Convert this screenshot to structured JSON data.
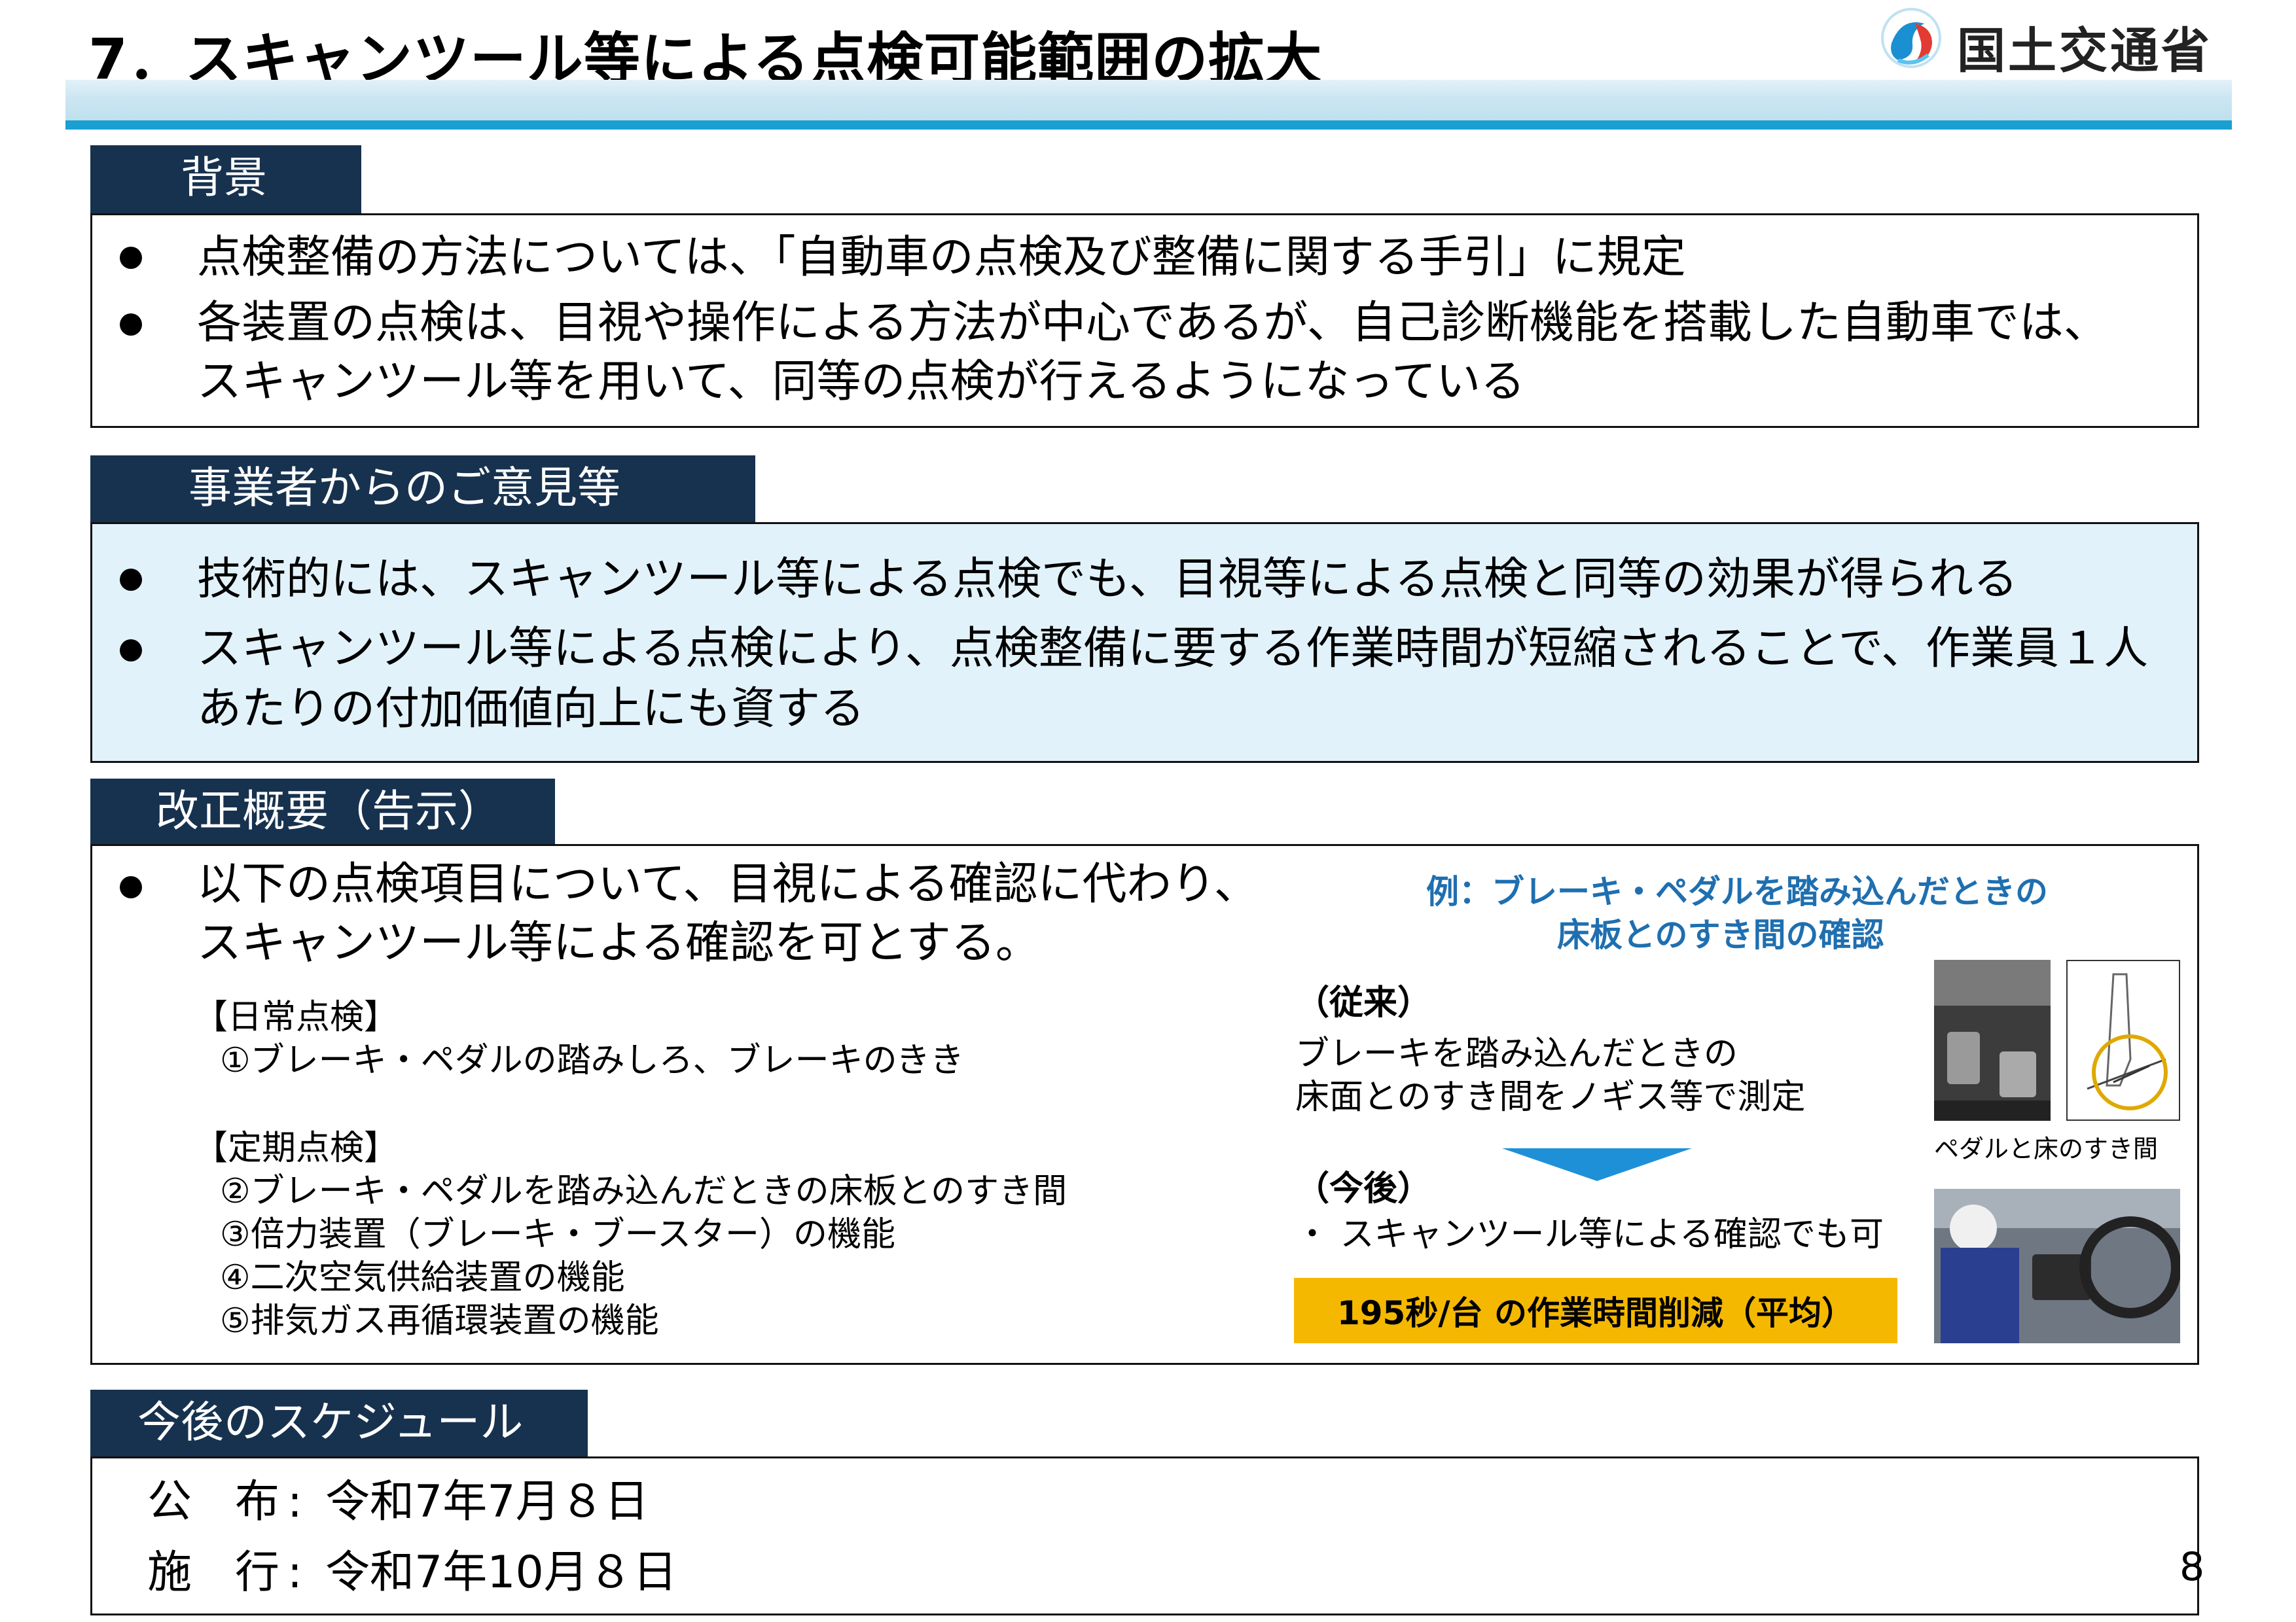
{
  "header": {
    "title": "7．スキャンツール等による点検可能範囲の拡大",
    "ministry": "国土交通省"
  },
  "background": {
    "tab": "背景",
    "bullets": [
      [
        "点検整備の方法については、「自動車の点検及び整備に関する手引」に規定"
      ],
      [
        "各装置の点検は、目視や操作による方法が中心であるが、自己診断機能を搭載した自動車では、",
        "スキャンツール等を用いて、同等の点検が行えるようになっている"
      ]
    ]
  },
  "opinions": {
    "tab": "事業者からのご意見等",
    "bullets": [
      [
        "技術的には、スキャンツール等による点検でも、目視等による点検と同等の効果が得られる"
      ],
      [
        "スキャンツール等による点検により、点検整備に要する作業時間が短縮されることで、作業員１人",
        "あたりの付加価値向上にも資する"
      ]
    ]
  },
  "revision": {
    "tab": "改正概要（告示）",
    "bullet": [
      "以下の点検項目について、目視による確認に代わり、",
      "スキャンツール等による確認を可とする。"
    ],
    "daily_heading": "【日常点検】",
    "daily_items": [
      "①ブレーキ・ペダルの踏みしろ、ブレーキのきき"
    ],
    "periodic_heading": "【定期点検】",
    "periodic_items": [
      "②ブレーキ・ペダルを踏み込んだときの床板とのすき間",
      "③倍力装置（ブレーキ・ブースター）の機能",
      "④二次空気供給装置の機能",
      "⑤排気ガス再循環装置の機能"
    ],
    "example_title": [
      "例：ブレーキ・ペダルを踏み込んだときの",
      "床板とのすき間の確認"
    ],
    "before_label": "（従来）",
    "before_text": [
      "ブレーキを踏み込んだときの",
      "床面とのすき間をノギス等で測定"
    ],
    "after_label": "（今後）",
    "after_text": "・ スキャンツール等による確認でも可",
    "highlight": "195秒/台 の作業時間削減（平均）",
    "pedal_caption": "ペダルと床のすき間"
  },
  "schedule": {
    "tab": "今後のスケジュール",
    "rows": [
      {
        "label_a": "公",
        "label_b": "布",
        "value": "令和7年7月８日"
      },
      {
        "label_a": "施",
        "label_b": "行",
        "value": "令和7年10月８日"
      }
    ]
  },
  "page_number": "8",
  "colors": {
    "tab_bg": "#17324f",
    "band": "#1a9fd1",
    "opinions_bg": "#e2f2fb",
    "example_blue": "#1f6fb0",
    "highlight_bg": "#f5b800",
    "arrow": "#1e90d8"
  }
}
